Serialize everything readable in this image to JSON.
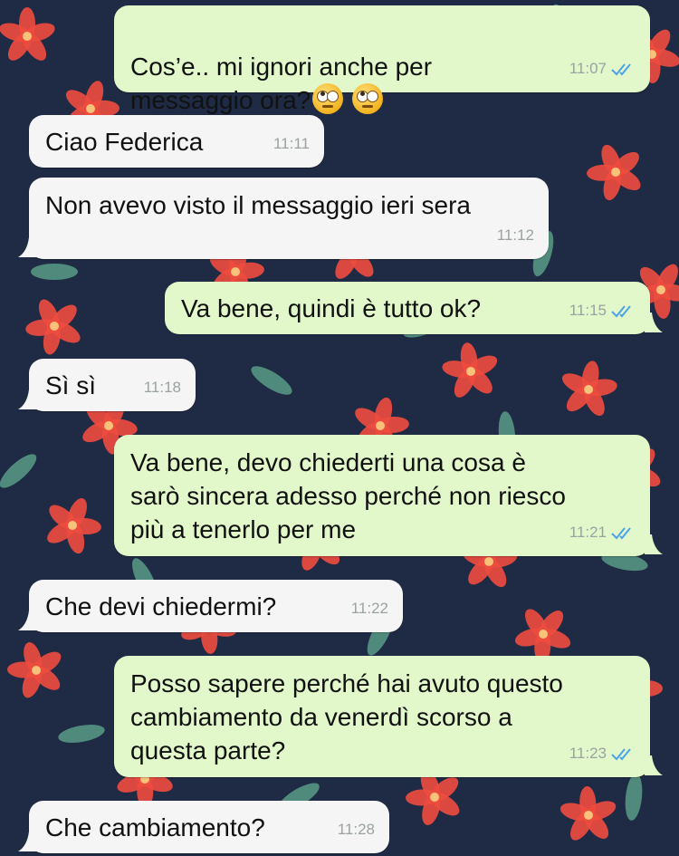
{
  "theme": {
    "wallpaper": "#1f2a44",
    "outgoing_bubble": "#e2f8cb",
    "incoming_bubble": "#f5f5f5",
    "read_ticks": "#4aa3e8",
    "petal": "#ef4b3f",
    "leaf": "#4f8a7c"
  },
  "messages": [
    {
      "direction": "out",
      "text": "Cos’e.. mi ignori anche per\nmessaggio ora?",
      "emoji": [
        "face-with-rolling-eyes",
        "face-with-rolling-eyes"
      ],
      "time": "11:07",
      "read": true
    },
    {
      "direction": "in",
      "text": "Ciao Federica",
      "time": "11:11"
    },
    {
      "direction": "in",
      "text": "Non avevo visto il messaggio ieri sera",
      "time": "11:12"
    },
    {
      "direction": "out",
      "text": "Va bene, quindi è tutto ok?",
      "time": "11:15",
      "read": true
    },
    {
      "direction": "in",
      "text": "Sì sì",
      "time": "11:18"
    },
    {
      "direction": "out",
      "text": "Va bene, devo chiederti una cosa è\nsarò sincera adesso perché non riesco\npiù a tenerlo per me",
      "time": "11:21",
      "read": true
    },
    {
      "direction": "in",
      "text": "Che devi chiedermi?",
      "time": "11:22"
    },
    {
      "direction": "out",
      "text": "Posso sapere perché hai avuto questo\ncambiamento da venerdì scorso a\nquesta parte?",
      "time": "11:23",
      "read": true
    },
    {
      "direction": "in",
      "text": "Che cambiamento?",
      "time": "11:28"
    }
  ]
}
